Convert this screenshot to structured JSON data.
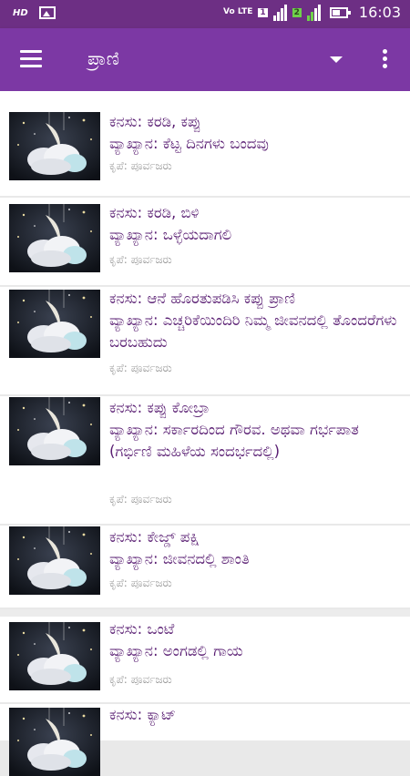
{
  "status_bar": {
    "hd": "HD",
    "volte": "Vo LTE",
    "sim1": "1",
    "sim2": "2",
    "time": "16:03"
  },
  "app_bar": {
    "title": "ಪ್ರಾಣಿ"
  },
  "items": [
    {
      "dream": "ಕನಸು: ಕರಡಿ, ಕಪ್ಪು",
      "meaning": "ವ್ಯಾಖ್ಯಾನ: ಕೆಟ್ಟ ದಿನಗಳು ಬಂದವು",
      "credit": "ಕೃಪೆ: ಪೂರ್ವಜರು"
    },
    {
      "dream": "ಕನಸು: ಕರಡಿ, ಬಿಳಿ",
      "meaning": "ವ್ಯಾಖ್ಯಾನ: ಒಳ್ಳೆಯದಾಗಲಿ",
      "credit": "ಕೃಪೆ: ಪೂರ್ವಜರು"
    },
    {
      "dream": "ಕನಸು: ಆನೆ ಹೊರತುಪಡಿಸಿ ಕಪ್ಪು ಪ್ರಾಣಿ",
      "meaning": "ವ್ಯಾಖ್ಯಾನ: ಎಚ್ಚರಿಕೆಯಿಂದಿರಿ ನಿಮ್ಮ ಜೀವನದಲ್ಲಿ ತೊಂದರೆಗಳು ಬರಬಹುದು",
      "credit": "ಕೃಪೆ: ಪೂರ್ವಜರು"
    },
    {
      "dream": "ಕನಸು: ಕಪ್ಪು ಕೋಬ್ರಾ",
      "meaning": "ವ್ಯಾಖ್ಯಾನ: ಸರ್ಕಾರದಿಂದ ಗೌರವ. ಅಥವಾ ಗರ್ಭಪಾತ (ಗರ್ಭಿಣಿ ಮಹಿಳೆಯ ಸಂದರ್ಭದಲ್ಲಿ)",
      "credit": "ಕೃಪೆ: ಪೂರ್ವಜರು"
    },
    {
      "dream": "ಕನಸು: ಕೇಜ್ಡ್ ಪಕ್ಷಿ",
      "meaning": "ವ್ಯಾಖ್ಯಾನ: ಜೀವನದಲ್ಲಿ ಶಾಂತಿ",
      "credit": "ಕೃಪೆ: ಪೂರ್ವಜರು"
    },
    {
      "dream": "ಕನಸು: ಒಂಟೆ",
      "meaning": "ವ್ಯಾಖ್ಯಾನ: ಅಂಗಡಲ್ಲಿ ಗಾಯ",
      "credit": "ಕೃಪೆ: ಪೂರ್ವಜರು"
    },
    {
      "dream": "ಕನಸು: ಕ್ಯಾಟ್",
      "meaning": "",
      "credit": ""
    }
  ]
}
